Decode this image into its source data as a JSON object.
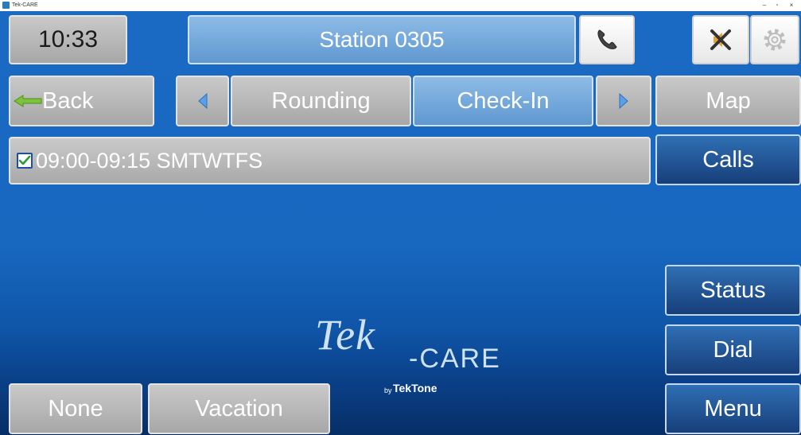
{
  "window": {
    "title": "Tek-CARE",
    "controls": {
      "minimize": "–",
      "maximize": "▫",
      "close": "×"
    }
  },
  "header": {
    "clock": "10:33",
    "station": "Station 0305"
  },
  "icons": {
    "phone": "phone-icon",
    "speaker_muted": "speaker-muted-icon",
    "gear": "gear-icon"
  },
  "nav": {
    "back": "Back",
    "tab_rounding": "Rounding",
    "tab_checkin": "Check-In",
    "map": "Map"
  },
  "schedule": {
    "items": [
      {
        "checked": true,
        "label": "09:00-09:15 SMTWTFS"
      }
    ]
  },
  "side": {
    "calls": "Calls",
    "status": "Status",
    "dial": "Dial",
    "menu": "Menu"
  },
  "bottom": {
    "none": "None",
    "vacation": "Vacation"
  },
  "logo": {
    "tek": "Tek",
    "care": "-CARE",
    "by": "by",
    "brand": "TekTone"
  },
  "colors": {
    "background": "#1868c0",
    "active_tab": "#7aaee0",
    "dark_button": "#1f4f92",
    "gray_button": "#b8b8b8",
    "back_arrow": "#7cc23a"
  }
}
